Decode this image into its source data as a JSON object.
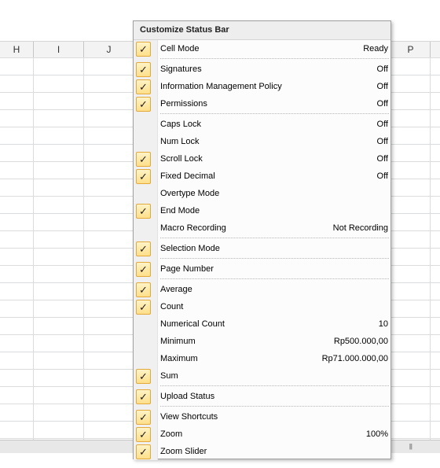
{
  "columns": [
    "H",
    "I",
    "J",
    "P"
  ],
  "menu": {
    "title": "Customize Status Bar",
    "items": [
      {
        "label": "Cell Mode",
        "value": "Ready",
        "checked": true
      },
      {
        "sep": true
      },
      {
        "label": "Signatures",
        "value": "Off",
        "checked": true
      },
      {
        "label": "Information Management Policy",
        "value": "Off",
        "checked": true
      },
      {
        "label": "Permissions",
        "value": "Off",
        "checked": true
      },
      {
        "sep": true
      },
      {
        "label": "Caps Lock",
        "value": "Off",
        "checked": false
      },
      {
        "label": "Num Lock",
        "value": "Off",
        "checked": false
      },
      {
        "label": "Scroll Lock",
        "value": "Off",
        "checked": true
      },
      {
        "label": "Fixed Decimal",
        "value": "Off",
        "checked": true
      },
      {
        "label": "Overtype Mode",
        "value": "",
        "checked": false
      },
      {
        "label": "End Mode",
        "value": "",
        "checked": true
      },
      {
        "label": "Macro Recording",
        "value": "Not Recording",
        "checked": false
      },
      {
        "sep": true
      },
      {
        "label": "Selection Mode",
        "value": "",
        "checked": true
      },
      {
        "sep": true
      },
      {
        "label": "Page Number",
        "value": "",
        "checked": true
      },
      {
        "sep": true
      },
      {
        "label": "Average",
        "value": "",
        "checked": true
      },
      {
        "label": "Count",
        "value": "",
        "checked": true
      },
      {
        "label": "Numerical Count",
        "value": "10",
        "checked": false
      },
      {
        "label": "Minimum",
        "value": "Rp500.000,00",
        "checked": false
      },
      {
        "label": "Maximum",
        "value": "Rp71.000.000,00",
        "checked": false
      },
      {
        "label": "Sum",
        "value": "",
        "checked": true
      },
      {
        "sep": true
      },
      {
        "label": "Upload Status",
        "value": "",
        "checked": true
      },
      {
        "sep": true
      },
      {
        "label": "View Shortcuts",
        "value": "",
        "checked": true
      },
      {
        "label": "Zoom",
        "value": "100%",
        "checked": true
      },
      {
        "label": "Zoom Slider",
        "value": "",
        "checked": true
      }
    ]
  },
  "icons": {
    "check": "checkmark-icon",
    "scroll_grip": "scroll-grip-icon"
  },
  "colors": {
    "check_bg": "#ffe08e",
    "check_border": "#e3a93a"
  }
}
